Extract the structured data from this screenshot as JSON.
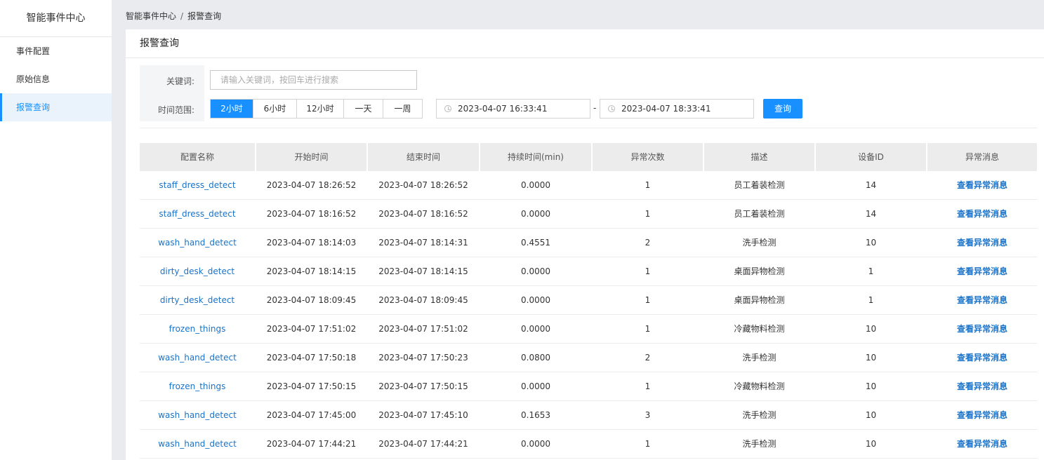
{
  "sidebar": {
    "title": "智能事件中心",
    "items": [
      {
        "label": "事件配置",
        "active": false
      },
      {
        "label": "原始信息",
        "active": false
      },
      {
        "label": "报警查询",
        "active": true
      }
    ]
  },
  "breadcrumb": {
    "root": "智能事件中心",
    "separator": "/",
    "current": "报警查询"
  },
  "page_title": "报警查询",
  "filter": {
    "keyword_label": "关键词:",
    "keyword_placeholder": "请输入关键词，按回车进行搜索",
    "keyword_value": "",
    "range_label": "时间范围:",
    "ranges": [
      "2小时",
      "6小时",
      "12小时",
      "一天",
      "一周"
    ],
    "active_range": "2小时",
    "start_time": "2023-04-07 16:33:41",
    "range_separator": "-",
    "end_time": "2023-04-07 18:33:41",
    "query_label": "查询"
  },
  "colors": {
    "accent": "#1890ff",
    "link": "#1a73c8",
    "header_bg": "#ececec",
    "page_bg": "#e9ebee"
  },
  "table": {
    "columns": [
      "配置名称",
      "开始时间",
      "结束时间",
      "持续时间(min)",
      "异常次数",
      "描述",
      "设备ID",
      "异常消息"
    ],
    "rows": [
      [
        "staff_dress_detect",
        "2023-04-07 18:26:52",
        "2023-04-07 18:26:52",
        "0.0000",
        "1",
        "员工着装检测",
        "14",
        "查看异常消息"
      ],
      [
        "staff_dress_detect",
        "2023-04-07 18:16:52",
        "2023-04-07 18:16:52",
        "0.0000",
        "1",
        "员工着装检测",
        "14",
        "查看异常消息"
      ],
      [
        "wash_hand_detect",
        "2023-04-07 18:14:03",
        "2023-04-07 18:14:31",
        "0.4551",
        "2",
        "洗手检测",
        "10",
        "查看异常消息"
      ],
      [
        "dirty_desk_detect",
        "2023-04-07 18:14:15",
        "2023-04-07 18:14:15",
        "0.0000",
        "1",
        "桌面异物检测",
        "1",
        "查看异常消息"
      ],
      [
        "dirty_desk_detect",
        "2023-04-07 18:09:45",
        "2023-04-07 18:09:45",
        "0.0000",
        "1",
        "桌面异物检测",
        "1",
        "查看异常消息"
      ],
      [
        "frozen_things",
        "2023-04-07 17:51:02",
        "2023-04-07 17:51:02",
        "0.0000",
        "1",
        "冷藏物料检测",
        "10",
        "查看异常消息"
      ],
      [
        "wash_hand_detect",
        "2023-04-07 17:50:18",
        "2023-04-07 17:50:23",
        "0.0800",
        "2",
        "洗手检测",
        "10",
        "查看异常消息"
      ],
      [
        "frozen_things",
        "2023-04-07 17:50:15",
        "2023-04-07 17:50:15",
        "0.0000",
        "1",
        "冷藏物料检测",
        "10",
        "查看异常消息"
      ],
      [
        "wash_hand_detect",
        "2023-04-07 17:45:00",
        "2023-04-07 17:45:10",
        "0.1653",
        "3",
        "洗手检测",
        "10",
        "查看异常消息"
      ],
      [
        "wash_hand_detect",
        "2023-04-07 17:44:21",
        "2023-04-07 17:44:21",
        "0.0000",
        "1",
        "洗手检测",
        "10",
        "查看异常消息"
      ]
    ]
  }
}
